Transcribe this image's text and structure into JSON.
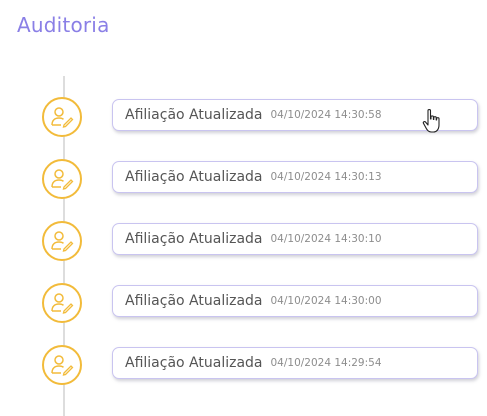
{
  "page": {
    "title": "Auditoria"
  },
  "colors": {
    "accent": "#8a7fe6",
    "icon_ring": "#f2bb3a",
    "card_border": "#c9c4f0"
  },
  "timeline": {
    "entries": [
      {
        "icon": "user-edit-icon",
        "label": "Afiliação Atualizada",
        "timestamp": "04/10/2024 14:30:58"
      },
      {
        "icon": "user-edit-icon",
        "label": "Afiliação Atualizada",
        "timestamp": "04/10/2024 14:30:13"
      },
      {
        "icon": "user-edit-icon",
        "label": "Afiliação Atualizada",
        "timestamp": "04/10/2024 14:30:10"
      },
      {
        "icon": "user-edit-icon",
        "label": "Afiliação Atualizada",
        "timestamp": "04/10/2024 14:30:00"
      },
      {
        "icon": "user-edit-icon",
        "label": "Afiliação Atualizada",
        "timestamp": "04/10/2024 14:29:54"
      }
    ]
  }
}
